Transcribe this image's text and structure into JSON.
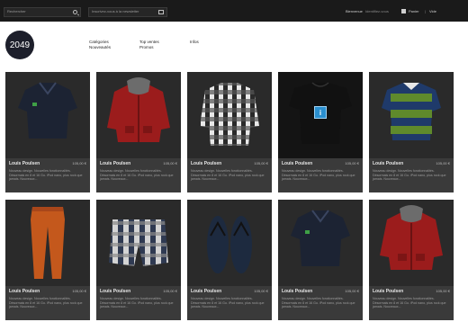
{
  "header": {
    "search_placeholder": "Rechercher",
    "newsletter_placeholder": "Inscrivez-vous à la newsletter",
    "welcome": "Bienvenue",
    "login": "Identifiez-vous",
    "cart_label": "Panier",
    "cart_separator": "|",
    "cart_status": "Vide"
  },
  "logo": "2049",
  "nav": [
    {
      "line1": "Catégories",
      "line2": "Nouveautés"
    },
    {
      "line1": "Top ventes",
      "line2": "Promos"
    },
    {
      "line1": "Infos",
      "line2": ""
    }
  ],
  "products": [
    {
      "title": "Louis Poulsen",
      "price": "105,00 €",
      "desc": "Nouveau design. Nouvelles fonctionnalités. Désormais en 8 et 16 Go. iPod nano, plus rock que jamais. Nouveaux...",
      "type": "polo",
      "color": "#1c2333"
    },
    {
      "title": "Louis Poulsen",
      "price": "105,00 €",
      "desc": "Nouveau design. Nouvelles fonctionnalités. Désormais en 8 et 16 Go. iPod nano, plus rock que jamais. Nouveaux...",
      "type": "hoodie",
      "color": "#9b1c1c"
    },
    {
      "title": "Louis Poulsen",
      "price": "105,00 €",
      "desc": "Nouveau design. Nouvelles fonctionnalités. Désormais en 8 et 16 Go. iPod nano, plus rock que jamais. Nouveaux...",
      "type": "plaid",
      "color": "#d8d8d8"
    },
    {
      "title": "Louis Poulsen",
      "price": "105,00 €",
      "desc": "Nouveau design. Nouvelles fonctionnalités. Désormais en 8 et 16 Go. iPod nano, plus rock que jamais. Nouveaux...",
      "type": "tee",
      "color": "#111111",
      "info": "i"
    },
    {
      "title": "Louis Poulsen",
      "price": "105,00 €",
      "desc": "Nouveau design. Nouvelles fonctionnalités. Désormais en 8 et 16 Go. iPod nano, plus rock que jamais. Nouveaux...",
      "type": "rugby",
      "color": "#5f8a2c"
    },
    {
      "title": "Louis Poulsen",
      "price": "105,00 €",
      "desc": "Nouveau design. Nouvelles fonctionnalités. Désormais en 8 et 16 Go. iPod nano, plus rock que jamais. Nouveaux...",
      "type": "pants",
      "color": "#c4581c"
    },
    {
      "title": "Louis Poulsen",
      "price": "105,00 €",
      "desc": "Nouveau design. Nouvelles fonctionnalités. Désormais en 8 et 16 Go. iPod nano, plus rock que jamais. Nouveaux...",
      "type": "shorts",
      "color": "#b9b9b9"
    },
    {
      "title": "Louis Poulsen",
      "price": "105,00 €",
      "desc": "Nouveau design. Nouvelles fonctionnalités. Désormais en 8 et 16 Go. iPod nano, plus rock que jamais. Nouveaux...",
      "type": "flipflops",
      "color": "#1d2a3f"
    },
    {
      "title": "Louis Poulsen",
      "price": "105,00 €",
      "desc": "Nouveau design. Nouvelles fonctionnalités. Désormais en 8 et 16 Go. iPod nano, plus rock que jamais. Nouveaux...",
      "type": "polo",
      "color": "#1c2333"
    },
    {
      "title": "Louis Poulsen",
      "price": "105,00 €",
      "desc": "Nouveau design. Nouvelles fonctionnalités. Désormais en 8 et 16 Go. iPod nano, plus rock que jamais. Nouveaux...",
      "type": "hoodie",
      "color": "#9b1c1c"
    }
  ]
}
